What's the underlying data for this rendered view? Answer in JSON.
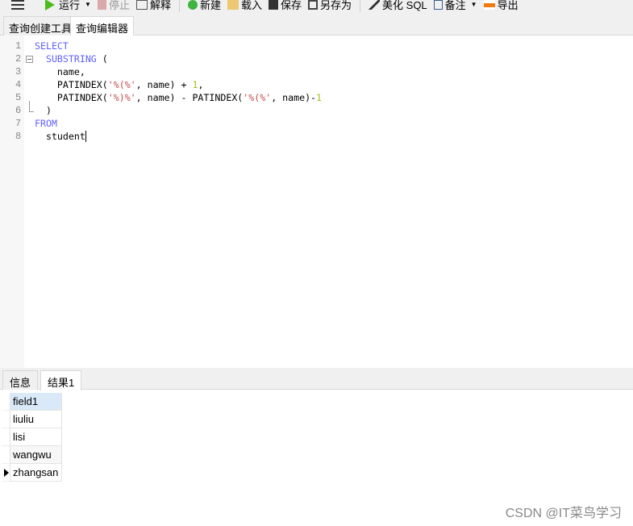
{
  "toolbar": {
    "run": "运行",
    "stop": "停止",
    "explain": "解释",
    "new": "新建",
    "load": "载入",
    "save": "保存",
    "save_as": "另存为",
    "beautify": "美化 SQL",
    "note": "备注",
    "export": "导出"
  },
  "tabs": [
    "查询创建工具",
    "查询编辑器"
  ],
  "editor": {
    "line_numbers": [
      "1",
      "2",
      "3",
      "4",
      "5",
      "6",
      "7",
      "8"
    ],
    "lines": [
      [
        {
          "t": "kw",
          "v": "SELECT"
        }
      ],
      [
        {
          "t": "pl",
          "v": "  "
        },
        {
          "t": "kw",
          "v": "SUBSTRING"
        },
        {
          "t": "pl",
          "v": " ("
        }
      ],
      [
        {
          "t": "pl",
          "v": "    name,"
        }
      ],
      [
        {
          "t": "pl",
          "v": "    PATINDEX("
        },
        {
          "t": "str",
          "v": "'%(%'"
        },
        {
          "t": "pl",
          "v": ", name) + "
        },
        {
          "t": "num",
          "v": "1"
        },
        {
          "t": "pl",
          "v": ","
        }
      ],
      [
        {
          "t": "pl",
          "v": "    PATINDEX("
        },
        {
          "t": "str",
          "v": "'%)%'"
        },
        {
          "t": "pl",
          "v": ", name) - PATINDEX("
        },
        {
          "t": "str",
          "v": "'%(%'"
        },
        {
          "t": "pl",
          "v": ", name)-"
        },
        {
          "t": "num",
          "v": "1"
        }
      ],
      [
        {
          "t": "pl",
          "v": "  )"
        }
      ],
      [
        {
          "t": "kw",
          "v": "FROM"
        }
      ],
      [
        {
          "t": "pl",
          "v": "  student"
        }
      ]
    ]
  },
  "result_tabs": [
    "信息",
    "结果1"
  ],
  "grid": {
    "header": "field1",
    "rows": [
      "liuliu",
      "lisi",
      "wangwu",
      "zhangsan"
    ]
  },
  "watermark": "CSDN @IT菜鸟学习",
  "colors": {
    "keyword": "#5f5fff",
    "string": "#c24a4a",
    "number": "#a0c020"
  }
}
